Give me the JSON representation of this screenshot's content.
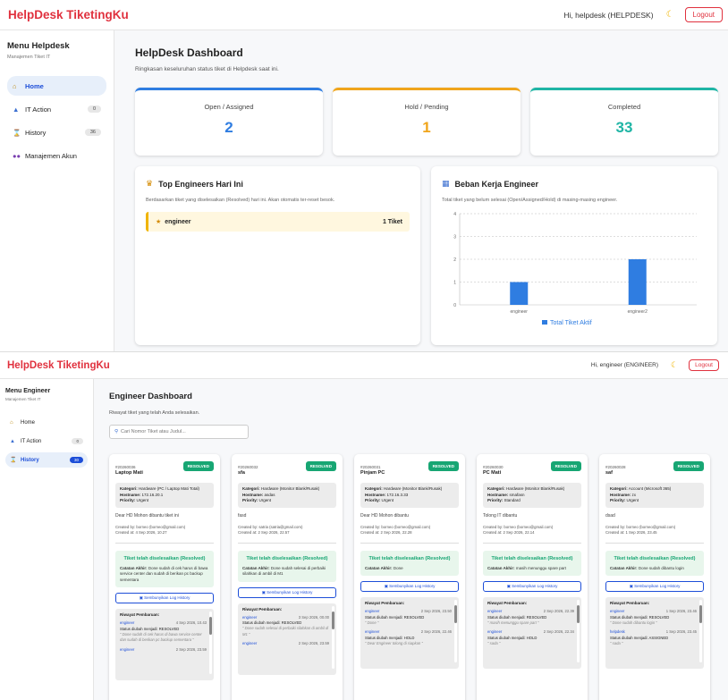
{
  "shot1": {
    "navbar": {
      "brand": "HelpDesk TiketingKu",
      "greeting": "Hi, helpdesk (HELPDESK)",
      "moon_icon": "moon-icon",
      "logout": "Logout"
    },
    "sidebar": {
      "title": "Menu Helpdesk",
      "subtitle": "Manajemen Tiket IT",
      "items": [
        {
          "label": "Home",
          "icon": "home-icon",
          "badge": ""
        },
        {
          "label": "IT Action",
          "icon": "flask-icon",
          "badge": "0"
        },
        {
          "label": "History",
          "icon": "hourglass-icon",
          "badge": "36"
        },
        {
          "label": "Manajemen Akun",
          "icon": "users-icon",
          "badge": ""
        }
      ]
    },
    "main": {
      "title": "HelpDesk Dashboard",
      "subtitle": "Ringkasan keseluruhan status tiket di Helpdesk saat ini.",
      "stats": [
        {
          "label": "Open / Assigned",
          "value": "2",
          "color": "#2f7de1"
        },
        {
          "label": "Hold / Pending",
          "value": "1",
          "color": "#f0a51b"
        },
        {
          "label": "Completed",
          "value": "33",
          "color": "#1fb5a5"
        }
      ],
      "top_engineers": {
        "title": "Top Engineers Hari Ini",
        "desc": "Berdasarkan tiket yang diselesaikan (Resolved) hari ini. Akan otomatis ter-reset besok.",
        "entry_name": "engineer",
        "entry_count": "1 Tiket"
      },
      "workload": {
        "title": "Beban Kerja Engineer",
        "desc": "Total tiket yang belum selesai (Open/Assigned/Hold) di masing-masing engineer."
      }
    }
  },
  "chart_data": {
    "type": "bar",
    "categories": [
      "engineer",
      "engineer2"
    ],
    "series": [
      {
        "name": "Total Tiket Aktif",
        "values": [
          1,
          2
        ],
        "color": "#2f7de1"
      }
    ],
    "ylim": [
      0,
      4
    ],
    "yticks": [
      "0",
      "1",
      "2",
      "3",
      "4"
    ],
    "grid": true,
    "legend": "bottom"
  },
  "shot2": {
    "navbar": {
      "brand": "HelpDesk TiketingKu",
      "greeting": "Hi, engineer (ENGINEER)",
      "moon_icon": "moon-icon",
      "logout": "Logout"
    },
    "sidebar": {
      "title": "Menu Engineer",
      "subtitle": "Manajemen Tiket IT",
      "items": [
        {
          "label": "Home",
          "icon": "home-icon",
          "badge": ""
        },
        {
          "label": "IT Action",
          "icon": "flask-icon",
          "badge": "0"
        },
        {
          "label": "History",
          "icon": "hourglass-icon",
          "badge": "30"
        }
      ]
    },
    "main": {
      "title": "Engineer Dashboard",
      "subtitle": "Riwayat tiket yang telah Anda selesaikan.",
      "search_placeholder": "Cari Nomor Tiket atau Judul..."
    },
    "labels": {
      "kategori": "Kategori:",
      "hostname": "Hostname:",
      "priority": "Priority:",
      "resolved_title": "Tiket telah diselesaikan (Resolved)",
      "catatan": "Catatan Akhir:",
      "hide_log": "Sembunyikan Log History",
      "riwayat": "Riwayat Pembaruan:"
    },
    "tickets": [
      {
        "number": "#20260036",
        "status": "RESOLVED",
        "title": "Laptop Mati",
        "kategori": "Hardware (PC / Laptop Mati Total)",
        "hostname": "172.16.20.1",
        "priority": "Urgent",
        "desc": "Dear HD Mohon dibantu tiket ini",
        "created_by": "Created by: borneo (borneo@gmail.com)",
        "created_at": "Created at: 4 Sep 2026, 10.27",
        "catatan": "Done sudah di cek harus di bawa service center dan sudah di berikan pc backup sementara",
        "logs": [
          {
            "user": "engineer",
            "time": "4 Sep 2026, 10.43",
            "status": "Status diubah menjadi: RESOLVED",
            "note": "\" Done sudah di cek harus di bawa service center dan sudah di berikan pc backup sementara \""
          },
          {
            "user": "engineer",
            "time": "2 Sep 2026, 23.59",
            "status": "",
            "note": ""
          }
        ]
      },
      {
        "number": "#20260032",
        "status": "RESOLVED",
        "title": "sfa",
        "kategori": "Hardware (Monitor Blank/Rusak)",
        "hostname": "asdas",
        "priority": "Urgent",
        "desc": "fasd",
        "created_by": "Created by: satria (satria@gmail.com)",
        "created_at": "Created at: 2 Sep 2026, 22.57",
        "catatan": "Done sudah selesai di perbaiki silahkan di ambil di M1",
        "logs": [
          {
            "user": "engineer",
            "time": "3 Sep 2026, 00.00",
            "status": "Status diubah menjadi: RESOLVED",
            "note": "\" Done sudah selesai di perbaiki silahkan di ambil di M1 \""
          },
          {
            "user": "engineer",
            "time": "2 Sep 2026, 23.59",
            "status": "",
            "note": ""
          }
        ]
      },
      {
        "number": "#20260031",
        "status": "RESOLVED",
        "title": "Pinjam PC",
        "kategori": "Hardware (Monitor Blank/Rusak)",
        "hostname": "172.16.3.33",
        "priority": "Urgent",
        "desc": "Dear HD Mohon dibantu",
        "created_by": "Created by: borneo (borneo@gmail.com)",
        "created_at": "Created at: 2 Sep 2026, 22.28",
        "catatan": "Done",
        "logs": [
          {
            "user": "engineer",
            "time": "2 Sep 2026, 23.50",
            "status": "Status diubah menjadi: RESOLVED",
            "note": "\" Done \""
          },
          {
            "user": "engineer",
            "time": "2 Sep 2026, 22.46",
            "status": "Status diubah menjadi: HOLD",
            "note": "\" Dear Engineer tolong di siapkan \""
          }
        ]
      },
      {
        "number": "#20260030",
        "status": "RESOLVED",
        "title": "PC Mati",
        "kategori": "Hardware (Monitor Blank/Rusak)",
        "hostname": "smafasn",
        "priority": "Standard",
        "desc": "Tolong IT dibantu",
        "created_by": "Created by: borneo (borneo@gmail.com)",
        "created_at": "Created at: 2 Sep 2026, 22.14",
        "catatan": "masih menunggu spare part",
        "logs": [
          {
            "user": "engineer",
            "time": "2 Sep 2026, 22.39",
            "status": "Status diubah menjadi: RESOLVED",
            "note": "\" masih menunggu spare part \""
          },
          {
            "user": "engineer",
            "time": "2 Sep 2026, 22.34",
            "status": "Status diubah menjadi: HOLD",
            "note": "\" sada \""
          }
        ]
      },
      {
        "number": "#20260028",
        "status": "RESOLVED",
        "title": "saf",
        "kategori": "Account (Microsoft 365)",
        "hostname": "zx",
        "priority": "Urgent",
        "desc": "dsad",
        "created_by": "Created by: borneo (borneo@gmail.com)",
        "created_at": "Created at: 1 Sep 2026, 23.45",
        "catatan": "Done sudah dibantu login",
        "logs": [
          {
            "user": "engineer",
            "time": "1 Sep 2026, 23.46",
            "status": "Status diubah menjadi: RESOLVED",
            "note": "\" Done sudah dibantu login \""
          },
          {
            "user": "helpdesk",
            "time": "1 Sep 2026, 23.45",
            "status": "Status diubah menjadi: ASSIGNED",
            "note": "\" sada \""
          }
        ]
      }
    ]
  }
}
